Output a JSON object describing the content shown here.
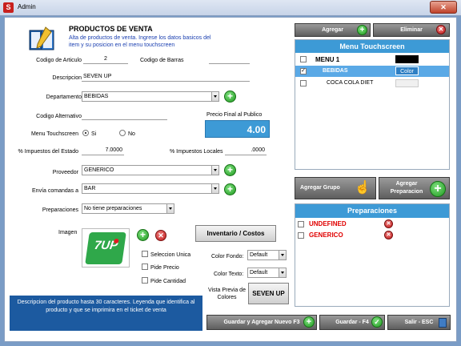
{
  "window": {
    "title": "Admin",
    "app_icon": "S",
    "close_glyph": "✕"
  },
  "header": {
    "title": "PRODUCTOS DE VENTA",
    "subtitle": "Alta de productos de venta. Ingrese los datos basicos del item y su posicion en el menu touchscreen"
  },
  "form": {
    "codigo_articulo": {
      "label": "Codigo de Articulo",
      "value": "2"
    },
    "codigo_barras": {
      "label": "Codigo de Barras",
      "value": ""
    },
    "descripcion": {
      "label": "Descripcion",
      "value": "SEVEN UP"
    },
    "departamento": {
      "label": "Departamento",
      "value": "BEBIDAS"
    },
    "codigo_alternativo": {
      "label": "Codigo Alternativo",
      "value": ""
    },
    "menu_touchscreen": {
      "label": "Menu Touchscreen",
      "si": "Si",
      "no": "No"
    },
    "precio_final": {
      "label": "Precio Final al Publico",
      "value": "4.00"
    },
    "impuestos_estado": {
      "label": "% Impuestos del Estado",
      "value": "7.0000"
    },
    "impuestos_locales": {
      "label": "% Impuestos Locales",
      "value": ".0000"
    },
    "proveedor": {
      "label": "Proveedor",
      "value": "GENERICO"
    },
    "envia_comandas": {
      "label": "Envía comandas a",
      "value": "BAR"
    },
    "preparaciones": {
      "label": "Preparaciones",
      "value": "No tiene preparaciones"
    },
    "imagen": {
      "label": "Imagen",
      "logo_text": "7UP"
    },
    "inventario_btn": "Inventario / Costos",
    "seleccion_unica": "Seleccion Unica",
    "pide_precio": "Pide Precio",
    "pide_cantidad": "Pide Cantidad",
    "color_fondo": {
      "label": "Color Fondo:",
      "value": "Default"
    },
    "color_texto": {
      "label": "Color Texto:",
      "value": "Default"
    },
    "vista_previa": {
      "label": "Vista Previa de Colores",
      "value": "SEVEN UP"
    },
    "hint": "Descripcion del producto hasta 30 caracteres. Leyenda que identifica al producto y que se imprimira en el ticket de venta"
  },
  "right": {
    "agregar": "Agregar",
    "eliminar": "Eliminar",
    "menu_title": "Menu Touchscreen",
    "menu_items": [
      {
        "label": "MENU 1",
        "checked": false
      },
      {
        "label": "BEBIDAS",
        "checked": true,
        "color_label": "Color"
      },
      {
        "label": "COCA COLA DIET",
        "checked": false
      }
    ],
    "agregar_grupo": "Agregar Grupo",
    "agregar_preparacion": "Agregar Preparacion",
    "prep_title": "Preparaciones",
    "prep_items": [
      "UNDEFINED",
      "GENERICO"
    ]
  },
  "footer": {
    "guardar_agregar": "Guardar y Agregar Nuevo F3",
    "guardar": "Guardar - F4",
    "salir": "Salir - ESC"
  },
  "colors": {
    "accent": "#3d9ad6",
    "hint_bg": "#1c5aa0",
    "price_bg": "#3d9ad6",
    "danger": "#e00000"
  }
}
